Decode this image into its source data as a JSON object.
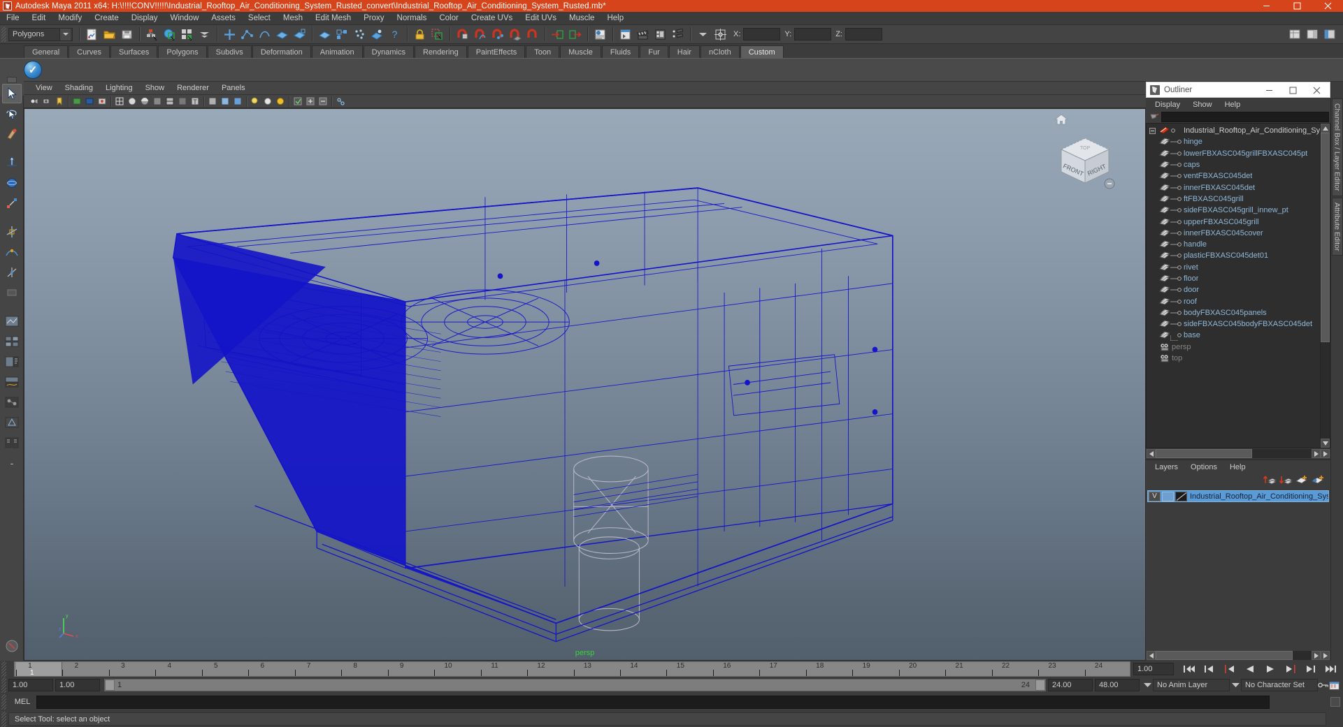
{
  "window": {
    "title": "Autodesk Maya 2011 x64: H:\\!!!!CONV!!!!!\\Industrial_Rooftop_Air_Conditioning_System_Rusted_convert\\Industrial_Rooftop_Air_Conditioning_System_Rusted.mb*",
    "minimize": "–",
    "maximize": "☐",
    "close": "✕",
    "accent_color": "#d6441b"
  },
  "menubar": {
    "items": [
      "File",
      "Edit",
      "Modify",
      "Create",
      "Display",
      "Window",
      "Assets",
      "Select",
      "Mesh",
      "Edit Mesh",
      "Proxy",
      "Normals",
      "Color",
      "Create UVs",
      "Edit UVs",
      "Muscle",
      "Help"
    ]
  },
  "statusline": {
    "mode_selector": "Polygons",
    "x_label": "X:",
    "y_label": "Y:",
    "z_label": "Z:",
    "x_value": "",
    "y_value": "",
    "z_value": ""
  },
  "shelf": {
    "tabs": [
      "General",
      "Curves",
      "Surfaces",
      "Polygons",
      "Subdivs",
      "Deformation",
      "Animation",
      "Dynamics",
      "Rendering",
      "PaintEffects",
      "Toon",
      "Muscle",
      "Fluids",
      "Fur",
      "Hair",
      "nCloth",
      "Custom"
    ],
    "active_tab": "Custom"
  },
  "viewport": {
    "menu": [
      "View",
      "Shading",
      "Lighting",
      "Show",
      "Renderer",
      "Panels"
    ],
    "camera_label": "persp",
    "viewcube": {
      "front": "FRONT",
      "right": "RIGHT",
      "top": "TOP"
    },
    "axis": {
      "x": "x",
      "y": "y",
      "z": "z"
    }
  },
  "outliner": {
    "title": "Outliner",
    "menu": [
      "Display",
      "Show",
      "Help"
    ],
    "search_value": "",
    "items": [
      {
        "label": "Industrial_Rooftop_Air_Conditioning_Sy",
        "type": "group",
        "root": true
      },
      {
        "label": "hinge",
        "type": "mesh"
      },
      {
        "label": "lowerFBXASC045grillFBXASC045pt",
        "type": "mesh"
      },
      {
        "label": "caps",
        "type": "mesh"
      },
      {
        "label": "ventFBXASC045det",
        "type": "mesh"
      },
      {
        "label": "innerFBXASC045det",
        "type": "mesh"
      },
      {
        "label": "ftFBXASC045grill",
        "type": "mesh"
      },
      {
        "label": "sideFBXASC045grill_innew_pt",
        "type": "mesh"
      },
      {
        "label": "upperFBXASC045grill",
        "type": "mesh"
      },
      {
        "label": "innerFBXASC045cover",
        "type": "mesh"
      },
      {
        "label": "handle",
        "type": "mesh"
      },
      {
        "label": "plasticFBXASC045det01",
        "type": "mesh"
      },
      {
        "label": "rivet",
        "type": "mesh"
      },
      {
        "label": "floor",
        "type": "mesh"
      },
      {
        "label": "door",
        "type": "mesh"
      },
      {
        "label": "roof",
        "type": "mesh"
      },
      {
        "label": "bodyFBXASC045panels",
        "type": "mesh"
      },
      {
        "label": "sideFBXASC045bodyFBXASC045det",
        "type": "mesh"
      },
      {
        "label": "base",
        "type": "mesh"
      },
      {
        "label": "persp",
        "type": "camera"
      },
      {
        "label": "top",
        "type": "camera"
      }
    ]
  },
  "layers": {
    "menu": [
      "Layers",
      "Options",
      "Help"
    ],
    "rows": [
      {
        "visibility": "V",
        "display_type": "",
        "name": "Industrial_Rooftop_Air_Conditioning_System",
        "selected": true
      }
    ]
  },
  "right_tabs": [
    "Channel Box / Layer Editor",
    "Attribute Editor"
  ],
  "timeline": {
    "frames": [
      1,
      2,
      3,
      4,
      5,
      6,
      7,
      8,
      9,
      10,
      11,
      12,
      13,
      14,
      15,
      16,
      17,
      18,
      19,
      20,
      21,
      22,
      23,
      24
    ],
    "current_frame": "1",
    "current_frame_field": "1.00",
    "playback_buttons": [
      "go-to-start",
      "step-back-key",
      "step-back-frame",
      "play-backwards",
      "play-forwards",
      "step-forward-frame",
      "step-forward-key",
      "go-to-end"
    ]
  },
  "range": {
    "anim_start": "1.00",
    "range_start": "1.00",
    "slider_start": "1",
    "slider_end": "24",
    "range_end": "24.00",
    "anim_end": "48.00",
    "anim_layer": "No Anim Layer",
    "character_set": "No Character Set"
  },
  "command": {
    "language": "MEL",
    "value": ""
  },
  "status": {
    "message": "Select Tool: select an object"
  }
}
